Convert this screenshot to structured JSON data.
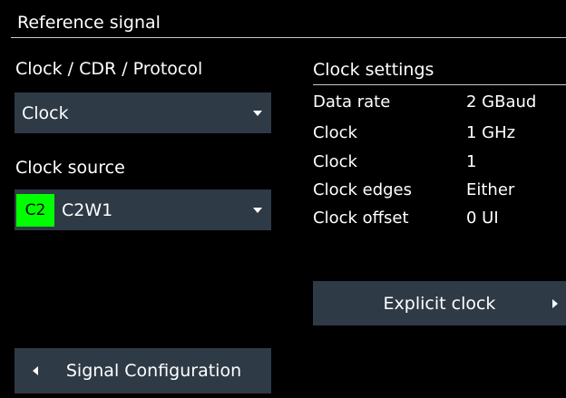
{
  "header": {
    "title": "Reference signal"
  },
  "clock_mode": {
    "label": "Clock / CDR / Protocol",
    "selected": "Clock",
    "caret_icon": "caret-down-icon"
  },
  "clock_source": {
    "label": "Clock source",
    "badge": "C2",
    "badge_color": "#00ff00",
    "selected": "C2W1",
    "caret_icon": "caret-down-icon"
  },
  "clock_settings": {
    "title": "Clock settings",
    "rows": [
      {
        "label": "Data rate",
        "value": "2 GBaud"
      },
      {
        "label": "Clock",
        "value": "1 GHz"
      },
      {
        "label": "Clock",
        "value": "1"
      },
      {
        "label": "Clock edges",
        "value": "Either"
      },
      {
        "label": "Clock offset",
        "value": "0 UI"
      }
    ]
  },
  "buttons": {
    "explicit_clock": "Explicit clock",
    "signal_configuration": "Signal Configuration"
  },
  "colors": {
    "background": "#000000",
    "control": "#2e3a46",
    "text": "#ffffff",
    "accent_badge": "#00ff00"
  }
}
